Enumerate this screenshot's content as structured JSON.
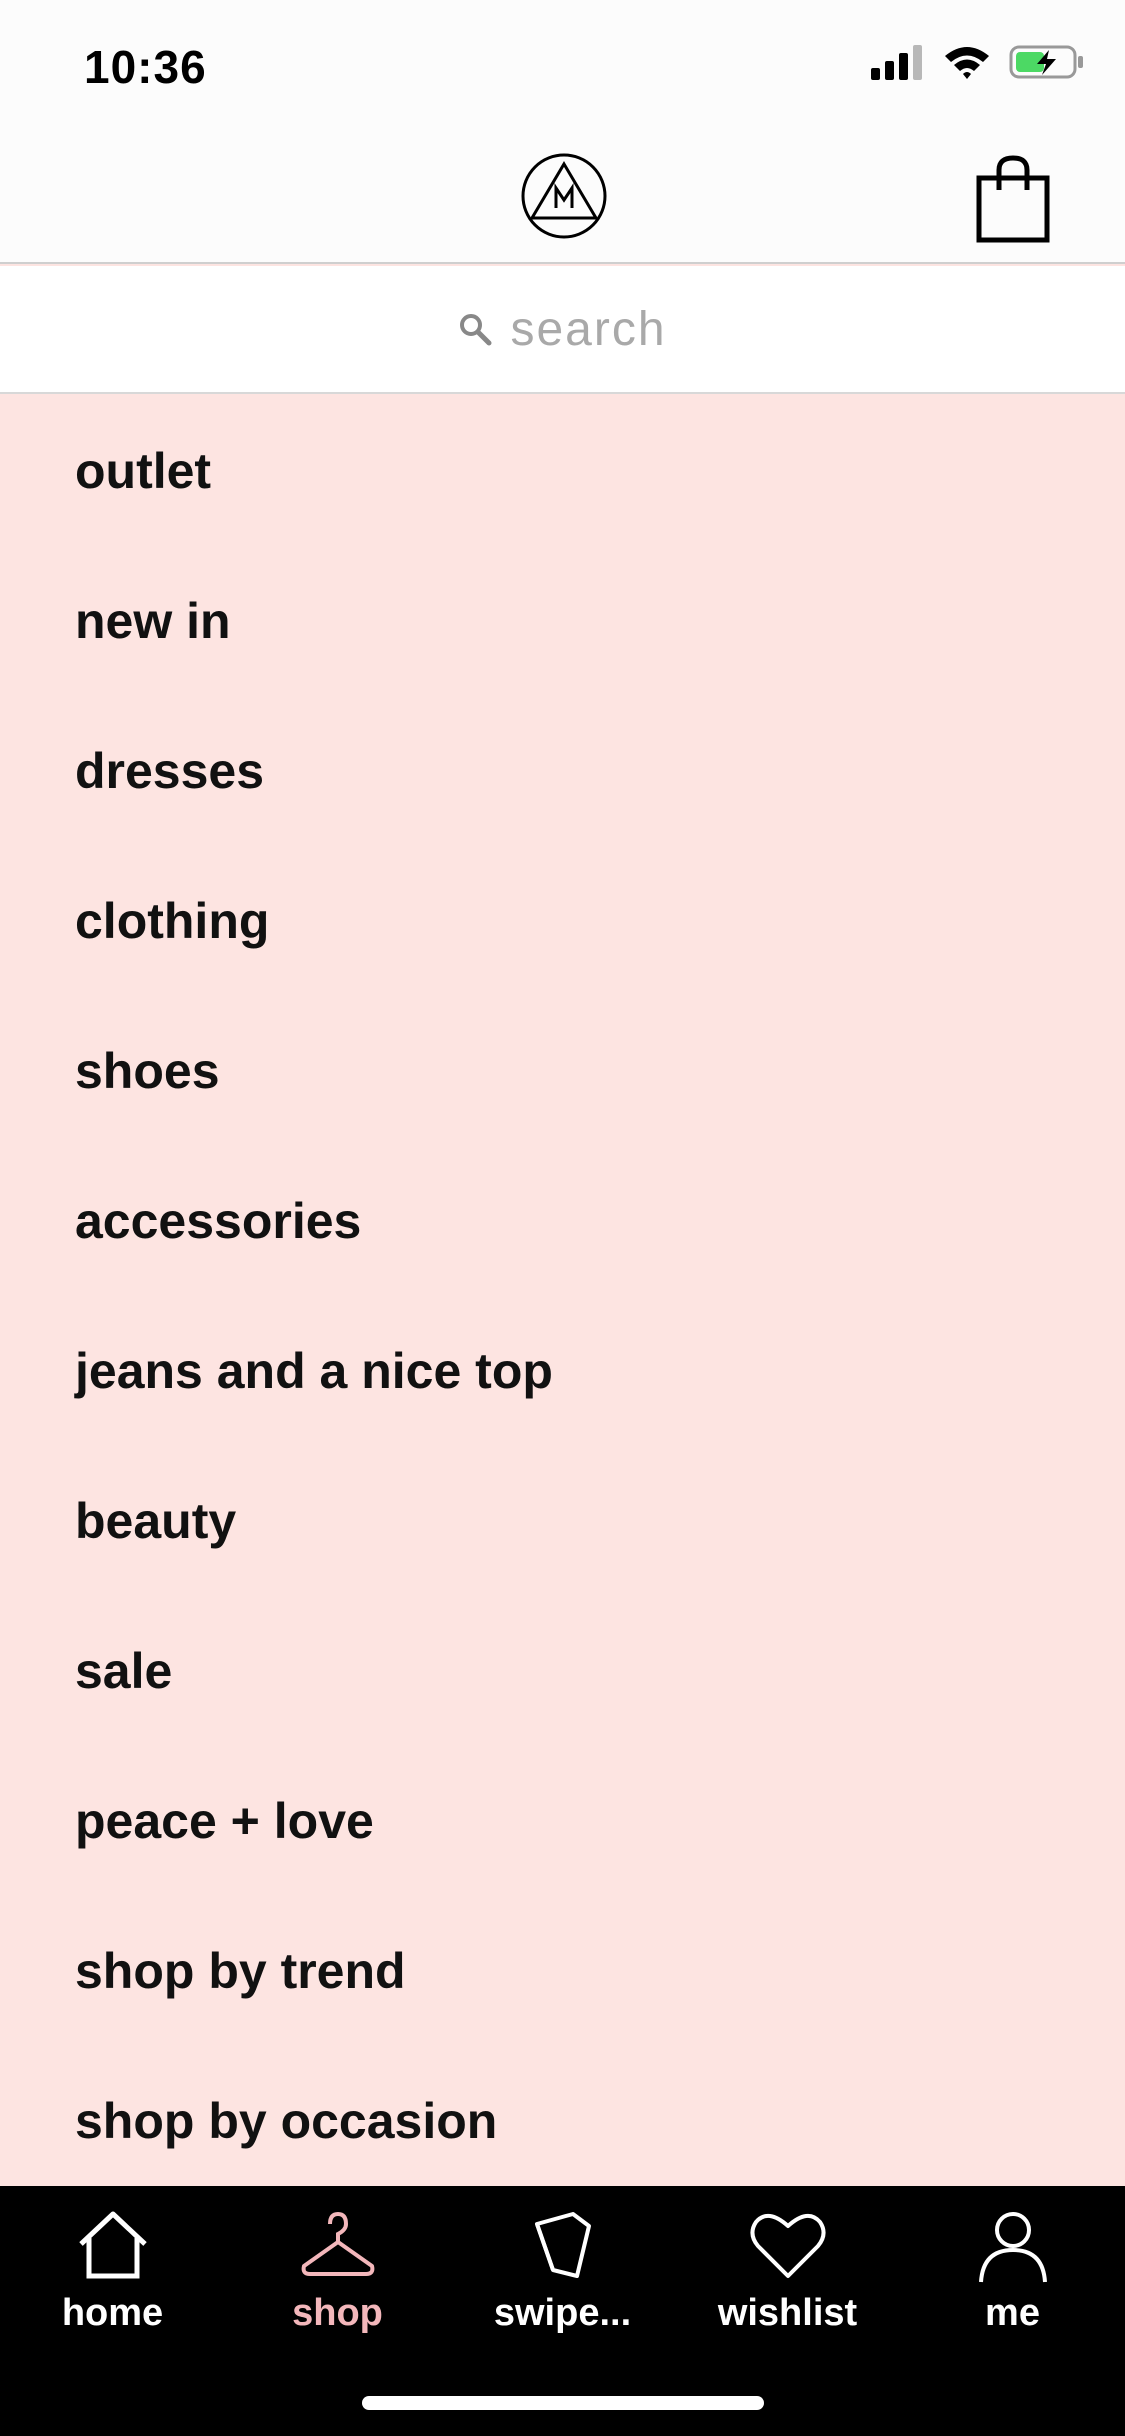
{
  "status_bar": {
    "time": "10:36"
  },
  "header": {
    "logo_icon": "missguided-logo-icon",
    "bag_icon": "shopping-bag-icon"
  },
  "search": {
    "placeholder": "search"
  },
  "menu": {
    "items": [
      {
        "label": "outlet"
      },
      {
        "label": "new in"
      },
      {
        "label": "dresses"
      },
      {
        "label": "clothing"
      },
      {
        "label": "shoes"
      },
      {
        "label": "accessories"
      },
      {
        "label": "jeans and a nice top"
      },
      {
        "label": "beauty"
      },
      {
        "label": "sale"
      },
      {
        "label": "peace + love"
      },
      {
        "label": "shop by trend"
      },
      {
        "label": "shop by occasion"
      }
    ]
  },
  "tab_bar": {
    "tabs": [
      {
        "label": "home",
        "icon": "home-icon"
      },
      {
        "label": "shop",
        "icon": "hanger-icon",
        "active": true
      },
      {
        "label": "swipe...",
        "icon": "cards-icon"
      },
      {
        "label": "wishlist",
        "icon": "heart-icon"
      },
      {
        "label": "me",
        "icon": "person-icon"
      }
    ]
  },
  "colors": {
    "background": "#fde4e1",
    "active_tab": "#f3b7bb",
    "tab_bar": "#000000"
  }
}
